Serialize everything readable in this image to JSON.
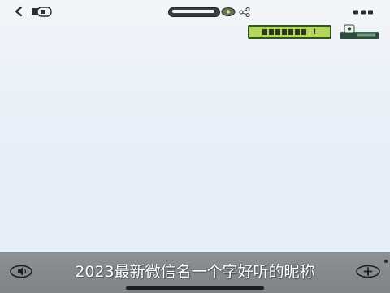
{
  "toolbar": {
    "icons": [
      "chevron-left-icon",
      "pages-icon",
      "reader-icon",
      "share-icon",
      "more-icon"
    ]
  },
  "banner": {
    "label_suffix": "!"
  },
  "caption": {
    "text": "2023最新微信名一个字好听的昵称"
  },
  "bottom": {
    "icons": [
      "audio-icon",
      "add-icon"
    ]
  },
  "colors": {
    "background": "#e9eff5",
    "banner_green": "#b5d65e",
    "banner_border": "#2f5a1e",
    "bottom_bar": "#8d9194",
    "caption_text": "#ffffff"
  }
}
